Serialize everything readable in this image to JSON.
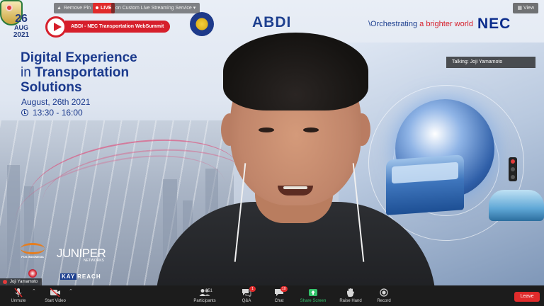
{
  "top_bar": {
    "pin_label": "Remove Pin",
    "live_label": "LIVE",
    "stream_label": "on Custom Live Streaming Service",
    "view_label": "View"
  },
  "banner": {
    "date_day": "26",
    "date_month": "AUG",
    "date_year": "2021",
    "summit_label": "ABDI - NEC Transportation WebSummit",
    "abdi_logo_text": "ABDI",
    "tagline_prefix": "\\Orchestrating ",
    "tagline_accent": "a brighter world",
    "nec_logo_text": "NEC",
    "title_line1": "Digital Experience",
    "title_line2_prefix": "in ",
    "title_line2": "Transportation",
    "title_line3": "Solutions",
    "event_date": "August, 26th 2021",
    "event_time": "13:30 - 16:00",
    "sponsors": {
      "pos_label": "POS INDONESIA",
      "juniper": "JUNIPER",
      "juniper_sub": "NETWORKS",
      "kay": "KAY",
      "reach": "REACH"
    }
  },
  "speaker": {
    "talking_label": "Talking: Joji Yamamoto",
    "name_tag": "Joji Yamamoto"
  },
  "toolbar": {
    "unmute": "Unmute",
    "start_video": "Start Video",
    "participants": "Participants",
    "participants_count": "351",
    "qa": "Q&A",
    "qa_badge": "1",
    "chat": "Chat",
    "chat_badge": "10",
    "share_screen": "Share Screen",
    "raise_hand": "Raise Hand",
    "record": "Record",
    "leave": "Leave"
  },
  "colors": {
    "brand_blue": "#1b3a8d",
    "brand_red": "#d61f2b",
    "share_green": "#34c26b",
    "toolbar_bg": "#1c1c1c"
  }
}
